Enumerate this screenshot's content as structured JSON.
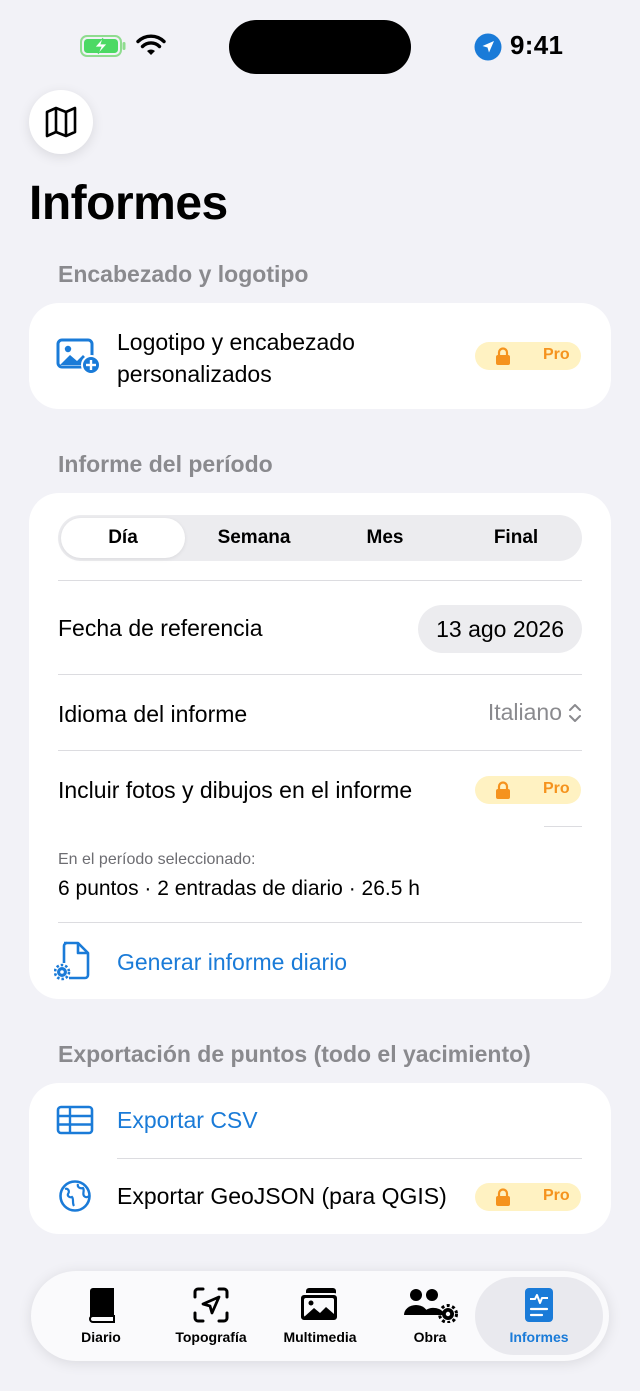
{
  "status_bar": {
    "time": "9:41"
  },
  "page": {
    "title": "Informes"
  },
  "sections": {
    "header_logo": {
      "title": "Encabezado y logotipo",
      "row_line1": "Logotipo y encabezado",
      "row_line2": "personalizados",
      "pro_label": "Pro"
    },
    "period": {
      "title": "Informe del período",
      "segments": [
        "Día",
        "Semana",
        "Mes",
        "Final"
      ],
      "selected_segment": "Día",
      "reference_date_label": "Fecha de referencia",
      "reference_date_value": "13 ago 2026",
      "language_label": "Idioma del informe",
      "language_value": "Italiano",
      "photos_label": "Incluir fotos y dibujos en el informe",
      "photos_pro_label": "Pro",
      "summary_caption": "En el período seleccionado:",
      "summary_text": "6 puntos · 2 entradas de diario · 26.5 h",
      "generate_label": "Generar informe diario"
    },
    "export": {
      "title": "Exportación de puntos (todo el yacimiento)",
      "csv_label": "Exportar CSV",
      "geojson_label": "Exportar GeoJSON (para QGIS)",
      "geojson_pro_label": "Pro"
    }
  },
  "tab_bar": {
    "tabs": [
      {
        "label": "Diario"
      },
      {
        "label": "Topografía"
      },
      {
        "label": "Multimedia"
      },
      {
        "label": "Obra"
      },
      {
        "label": "Informes"
      }
    ],
    "active": "Informes"
  },
  "colors": {
    "accent": "#1a7bd8",
    "pro_badge_bg": "#fff2c2",
    "pro_badge_fg": "#f5931e",
    "background": "#f2f2f7"
  }
}
